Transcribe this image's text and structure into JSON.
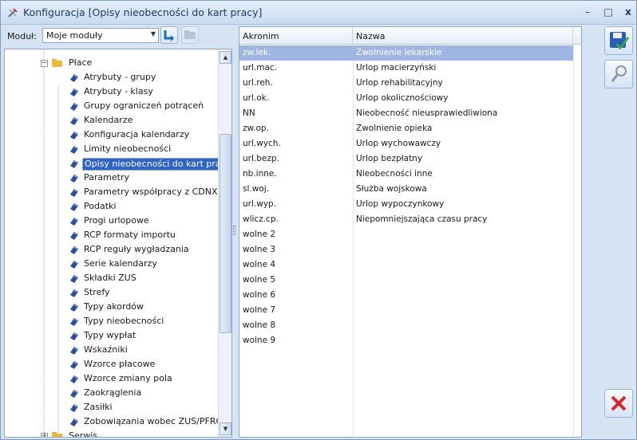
{
  "window": {
    "title": "Konfiguracja [Opisy nieobecności do kart pracy]",
    "minimize": "–",
    "maximize": "□",
    "close": "x"
  },
  "module": {
    "label": "Moduł:",
    "selected": "Moje moduły"
  },
  "tree": {
    "parent": "Płace",
    "items": [
      "Atrybuty - grupy",
      "Atrybuty - klasy",
      "Grupy ograniczeń potrąceń",
      "Kalendarze",
      "Konfiguracja kalendarzy",
      "Limity nieobecności",
      "Opisy nieobecności do kart pracy",
      "Parametry",
      "Parametry współpracy z CDNXL",
      "Podatki",
      "Progi urlopowe",
      "RCP formaty importu",
      "RCP reguły wygładzania",
      "Serie kalendarzy",
      "Składki ZUS",
      "Strefy",
      "Typy akordów",
      "Typy nieobecności",
      "Typy wypłat",
      "Wskaźniki",
      "Wzorce płacowe",
      "Wzorce zmiany pola",
      "Zaokrąglenia",
      "Zasiłki",
      "Zobowiązania wobec ZUS/PFRON"
    ],
    "selected_item": "Opisy nieobecności do kart pracy",
    "next_group": "Serwis"
  },
  "grid": {
    "columns": [
      "Akronim",
      "Nazwa"
    ],
    "rows": [
      {
        "akronim": "zw.lek.",
        "nazwa": "Zwolnienie lekarskie"
      },
      {
        "akronim": "url.mac.",
        "nazwa": "Urlop macierzyński"
      },
      {
        "akronim": "url.reh.",
        "nazwa": "Urlop rehabilitacyjny"
      },
      {
        "akronim": "url.ok.",
        "nazwa": "Urlop okolicznościowy"
      },
      {
        "akronim": "NN",
        "nazwa": "Nieobecność nieusprawiedliwiona"
      },
      {
        "akronim": "zw.op.",
        "nazwa": "Zwolnienie opieka"
      },
      {
        "akronim": "url.wych.",
        "nazwa": "Urlop wychowawczy"
      },
      {
        "akronim": "url.bezp.",
        "nazwa": "Urlop bezpłatny"
      },
      {
        "akronim": "nb.inne.",
        "nazwa": "Nieobecności inne"
      },
      {
        "akronim": "sl.woj.",
        "nazwa": "Służba wojskowa"
      },
      {
        "akronim": "url.wyp.",
        "nazwa": "Urlop wypoczynkowy"
      },
      {
        "akronim": "wlicz.cp.",
        "nazwa": "Niepomniejszająca czasu pracy"
      },
      {
        "akronim": "wolne 2",
        "nazwa": ""
      },
      {
        "akronim": "wolne 3",
        "nazwa": ""
      },
      {
        "akronim": "wolne 4",
        "nazwa": ""
      },
      {
        "akronim": "wolne 5",
        "nazwa": ""
      },
      {
        "akronim": "wolne 6",
        "nazwa": ""
      },
      {
        "akronim": "wolne 7",
        "nazwa": ""
      },
      {
        "akronim": "wolne 8",
        "nazwa": ""
      },
      {
        "akronim": "wolne 9",
        "nazwa": ""
      }
    ],
    "selected_row": 0
  },
  "colors": {
    "selection": "#2f63c7",
    "grid_selection": "#9fb6e4",
    "cancel_red": "#d8262b",
    "save_blue": "#2a5db8"
  }
}
